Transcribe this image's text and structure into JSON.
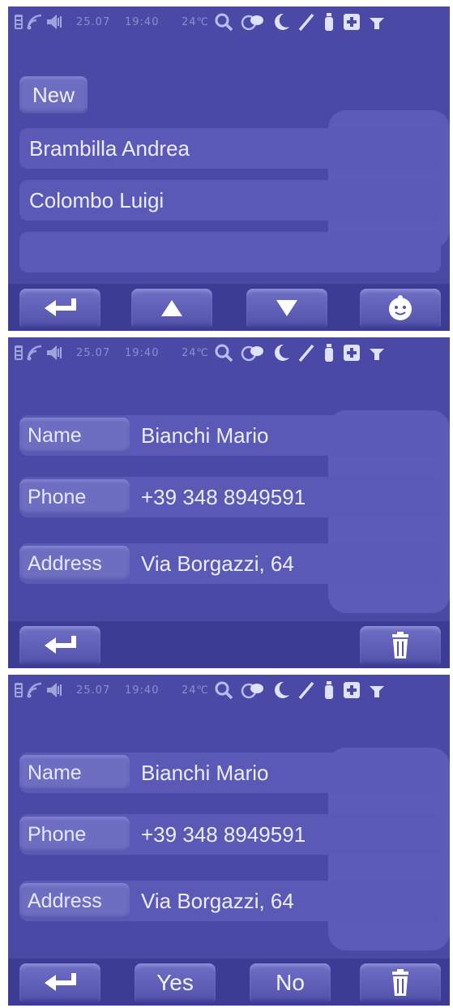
{
  "status_bar": {
    "date": "25.07",
    "time": "19:40",
    "temperature": "24℃",
    "icons": [
      "battery-icon",
      "signal-icon",
      "speaker-icon",
      "search-icon",
      "chat-icon",
      "moon-icon",
      "pen-icon",
      "bottle-icon",
      "medical-cross-icon",
      "antenna-icon"
    ]
  },
  "screen_list": {
    "new_button": "New",
    "contacts": [
      "Brambilla Andrea",
      "Colombo Luigi",
      ""
    ],
    "buttons": [
      "back-icon",
      "up-arrow-icon",
      "down-arrow-icon",
      "baby-face-icon"
    ]
  },
  "screen_detail": {
    "name_label": "Name",
    "name_value": "Bianchi Mario",
    "phone_label": "Phone",
    "phone_value": "+39 348 8949591",
    "address_label": "Address",
    "address_value": "Via Borgazzi, 64",
    "buttons": [
      "back-icon",
      "trash-icon"
    ]
  },
  "screen_confirm": {
    "name_label": "Name",
    "name_value": "Bianchi Mario",
    "phone_label": "Phone",
    "phone_value": "+39 348 8949591",
    "address_label": "Address",
    "address_value": "Via Borgazzi, 64",
    "yes_label": "Yes",
    "no_label": "No"
  }
}
